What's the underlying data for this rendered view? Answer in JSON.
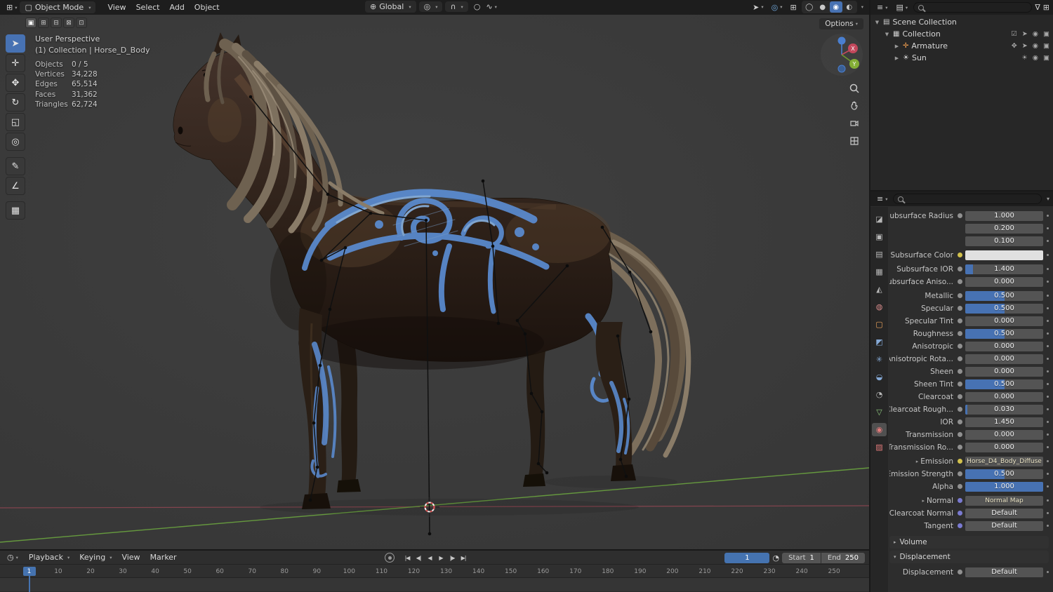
{
  "colors": {
    "accent_blue": "#4772b3",
    "pattern_blue": "#5c8fd6",
    "axis_green": "#6aa33f",
    "axis_red": "#c14e60",
    "socket_yellow": "#d2c14d",
    "socket_vector": "#7a7ad1"
  },
  "topbar": {
    "mode_label": "Object Mode",
    "menus": [
      "View",
      "Select",
      "Add",
      "Object"
    ],
    "orientation_label": "Global",
    "shading_modes": [
      {
        "name": "wireframe",
        "glyph": "◯",
        "active": false
      },
      {
        "name": "solid",
        "glyph": "●",
        "active": false
      },
      {
        "name": "material-preview",
        "glyph": "◉",
        "active": true
      },
      {
        "name": "rendered",
        "glyph": "◐",
        "active": false
      }
    ]
  },
  "tool_settings": {
    "modes": [
      {
        "name": "select-set",
        "glyph": "▣",
        "active": true
      },
      {
        "name": "select-extend",
        "glyph": "⊞",
        "active": false
      },
      {
        "name": "select-subtract",
        "glyph": "⊟",
        "active": false
      },
      {
        "name": "select-invert",
        "glyph": "⊠",
        "active": false
      },
      {
        "name": "select-intersect",
        "glyph": "⊡",
        "active": false
      }
    ]
  },
  "toolbar": {
    "tools": [
      {
        "name": "select-box",
        "glyph": "➤",
        "active": true
      },
      {
        "name": "cursor",
        "glyph": "✛",
        "active": false
      },
      {
        "name": "move",
        "glyph": "✥",
        "active": false
      },
      {
        "name": "rotate",
        "glyph": "↻",
        "active": false
      },
      {
        "name": "scale",
        "glyph": "◱",
        "active": false
      },
      {
        "name": "transform",
        "glyph": "◎",
        "active": false
      },
      {
        "name": "annotate",
        "glyph": "✎",
        "active": false,
        "gap_before": true
      },
      {
        "name": "measure",
        "glyph": "∠",
        "active": false
      },
      {
        "name": "add-cube",
        "glyph": "▦",
        "active": false,
        "gap_before": true
      }
    ]
  },
  "viewport": {
    "options_label": "Options",
    "perspective_label": "User Perspective",
    "context_label": "(1) Collection | Horse_D_Body",
    "stats": [
      {
        "label": "Objects",
        "value": "0 / 5"
      },
      {
        "label": "Vertices",
        "value": "34,228"
      },
      {
        "label": "Edges",
        "value": "65,514"
      },
      {
        "label": "Faces",
        "value": "31,362"
      },
      {
        "label": "Triangles",
        "value": "62,724"
      }
    ],
    "gizmo": {
      "x_label": "X",
      "y_label": "Y"
    }
  },
  "outliner": {
    "rows": [
      {
        "label": "Scene Collection",
        "depth": 0,
        "expander": "▼",
        "icon_name": "scene-collection-icon",
        "icon_glyph": "▤",
        "icon_color": "#cfcfcf",
        "right_icons": []
      },
      {
        "label": "Collection",
        "depth": 1,
        "expander": "▼",
        "icon_name": "collection-icon",
        "icon_glyph": "▦",
        "icon_color": "#cfcfcf",
        "right_icons": [
          {
            "name": "checkbox",
            "glyph": "☑"
          },
          {
            "name": "selectable",
            "glyph": "➤"
          },
          {
            "name": "hide-viewport-eye",
            "glyph": "◉"
          },
          {
            "name": "disable-render-camera",
            "glyph": "▣"
          }
        ]
      },
      {
        "label": "Armature",
        "depth": 2,
        "expander": "▶",
        "icon_name": "armature-icon",
        "icon_glyph": "✛",
        "icon_color": "#ef9d4f",
        "right_icons": [
          {
            "name": "pose",
            "glyph": "✥"
          },
          {
            "name": "selectable",
            "glyph": "➤"
          },
          {
            "name": "hide-viewport-eye",
            "glyph": "◉"
          },
          {
            "name": "disable-render-camera",
            "glyph": "▣"
          }
        ]
      },
      {
        "label": "Sun",
        "depth": 2,
        "expander": "▶",
        "icon_name": "sun-light-icon",
        "icon_glyph": "☀",
        "icon_color": "#d8d8d8",
        "right_icons": [
          {
            "name": "light-data",
            "glyph": "☀"
          },
          {
            "name": "hide-viewport-eye",
            "glyph": "◉"
          },
          {
            "name": "disable-render-camera",
            "glyph": "▣"
          }
        ]
      }
    ]
  },
  "properties": {
    "tabs": [
      {
        "name": "tool",
        "glyph": "◪",
        "color": "#b8b8b8",
        "active": false
      },
      {
        "name": "render",
        "glyph": "▣",
        "color": "#b8b8b8",
        "active": false
      },
      {
        "name": "output",
        "glyph": "▤",
        "color": "#b8b8b8",
        "active": false
      },
      {
        "name": "view-layer",
        "glyph": "▦",
        "color": "#b8b8b8",
        "active": false
      },
      {
        "name": "scene",
        "glyph": "◭",
        "color": "#b8b8b8",
        "active": false
      },
      {
        "name": "world",
        "glyph": "◍",
        "color": "#d98c8c",
        "active": false
      },
      {
        "name": "object",
        "glyph": "▢",
        "color": "#e8a15c",
        "active": false
      },
      {
        "name": "modifiers",
        "glyph": "◩",
        "color": "#85a9d6",
        "active": false
      },
      {
        "name": "particles",
        "glyph": "✳",
        "color": "#85a9d6",
        "active": false
      },
      {
        "name": "physics",
        "glyph": "◒",
        "color": "#85a9d6",
        "active": false
      },
      {
        "name": "constraints",
        "glyph": "◔",
        "color": "#b8b8b8",
        "active": false
      },
      {
        "name": "object-data",
        "glyph": "▽",
        "color": "#8fc97f",
        "active": false
      },
      {
        "name": "material",
        "glyph": "◉",
        "color": "#e07a7a",
        "active": true
      },
      {
        "name": "texture",
        "glyph": "▨",
        "color": "#e07a7a",
        "active": false
      }
    ],
    "rows": [
      {
        "type": "number",
        "label": "Subsurface Radius",
        "value": "1.000",
        "socket": "gray"
      },
      {
        "type": "number",
        "label": "",
        "value": "0.200",
        "socket": "none"
      },
      {
        "type": "number",
        "label": "",
        "value": "0.100",
        "socket": "none"
      },
      {
        "type": "color",
        "label": "Subsurface Color",
        "swatch": "#e0e0e0",
        "socket": "yellow",
        "gap_before": true
      },
      {
        "type": "slider",
        "label": "Subsurface IOR",
        "value": "1.400",
        "fill": 0.1,
        "socket": "gray",
        "gap_before": true
      },
      {
        "type": "slider",
        "label": "Subsurface Aniso...",
        "value": "0.000",
        "fill": 0,
        "socket": "gray"
      },
      {
        "type": "slider",
        "label": "Metallic",
        "value": "0.500",
        "fill": 0.5,
        "socket": "gray",
        "gap_before": true
      },
      {
        "type": "slider",
        "label": "Specular",
        "value": "0.500",
        "fill": 0.5,
        "socket": "gray"
      },
      {
        "type": "slider",
        "label": "Specular Tint",
        "value": "0.000",
        "fill": 0,
        "socket": "gray"
      },
      {
        "type": "slider",
        "label": "Roughness",
        "value": "0.500",
        "fill": 0.5,
        "socket": "gray"
      },
      {
        "type": "slider",
        "label": "Anisotropic",
        "value": "0.000",
        "fill": 0,
        "socket": "gray"
      },
      {
        "type": "slider",
        "label": "Anisotropic Rota...",
        "value": "0.000",
        "fill": 0,
        "socket": "gray"
      },
      {
        "type": "slider",
        "label": "Sheen",
        "value": "0.000",
        "fill": 0,
        "socket": "gray"
      },
      {
        "type": "slider",
        "label": "Sheen Tint",
        "value": "0.500",
        "fill": 0.5,
        "socket": "gray"
      },
      {
        "type": "slider",
        "label": "Clearcoat",
        "value": "0.000",
        "fill": 0,
        "socket": "gray"
      },
      {
        "type": "slider",
        "label": "Clearcoat Rough...",
        "value": "0.030",
        "fill": 0.03,
        "socket": "gray"
      },
      {
        "type": "number",
        "label": "IOR",
        "value": "1.450",
        "socket": "gray"
      },
      {
        "type": "slider",
        "label": "Transmission",
        "value": "0.000",
        "fill": 0,
        "socket": "gray"
      },
      {
        "type": "slider",
        "label": "Transmission Ro...",
        "value": "0.000",
        "fill": 0,
        "socket": "gray"
      },
      {
        "type": "link",
        "label": "Emission",
        "value": "Horse_D4_Body_Diffuse",
        "socket": "yellow",
        "expander": true,
        "gap_before": true
      },
      {
        "type": "slider",
        "label": "Emission Strength",
        "value": "0.500",
        "fill": 0.5,
        "socket": "gray"
      },
      {
        "type": "slider",
        "label": "Alpha",
        "value": "1.000",
        "fill": 1,
        "socket": "gray"
      },
      {
        "type": "link",
        "label": "Normal",
        "value": "Normal Map",
        "socket": "vector",
        "expander": true,
        "gap_before": true
      },
      {
        "type": "menu",
        "label": "Clearcoat Normal",
        "value": "Default",
        "socket": "vector"
      },
      {
        "type": "menu",
        "label": "Tangent",
        "value": "Default",
        "socket": "vector"
      },
      {
        "type": "section",
        "label": "Volume",
        "collapsed": true,
        "gap_before": true
      },
      {
        "type": "section",
        "label": "Displacement",
        "collapsed": false
      },
      {
        "type": "menu",
        "label": "Displacement",
        "value": "Default",
        "socket": "gray",
        "gap_before": true
      }
    ]
  },
  "timeline": {
    "menus": [
      {
        "label": "Playback",
        "chevron": true
      },
      {
        "label": "Keying",
        "chevron": true
      },
      {
        "label": "View",
        "chevron": false
      },
      {
        "label": "Marker",
        "chevron": false
      }
    ],
    "playback": [
      {
        "name": "jump-to-start",
        "glyph": "|◀"
      },
      {
        "name": "prev-keyframe",
        "glyph": "◀|"
      },
      {
        "name": "play-reverse",
        "glyph": "◀"
      },
      {
        "name": "play",
        "glyph": "▶"
      },
      {
        "name": "next-keyframe",
        "glyph": "|▶"
      },
      {
        "name": "jump-to-end",
        "glyph": "▶|"
      }
    ],
    "current_frame": "1",
    "start_label": "Start",
    "start_value": "1",
    "end_label": "End",
    "end_value": "250",
    "ticks": [
      1,
      10,
      20,
      30,
      40,
      50,
      60,
      70,
      80,
      90,
      100,
      110,
      120,
      130,
      140,
      150,
      160,
      170,
      180,
      190,
      200,
      210,
      220,
      230,
      240,
      250
    ]
  }
}
